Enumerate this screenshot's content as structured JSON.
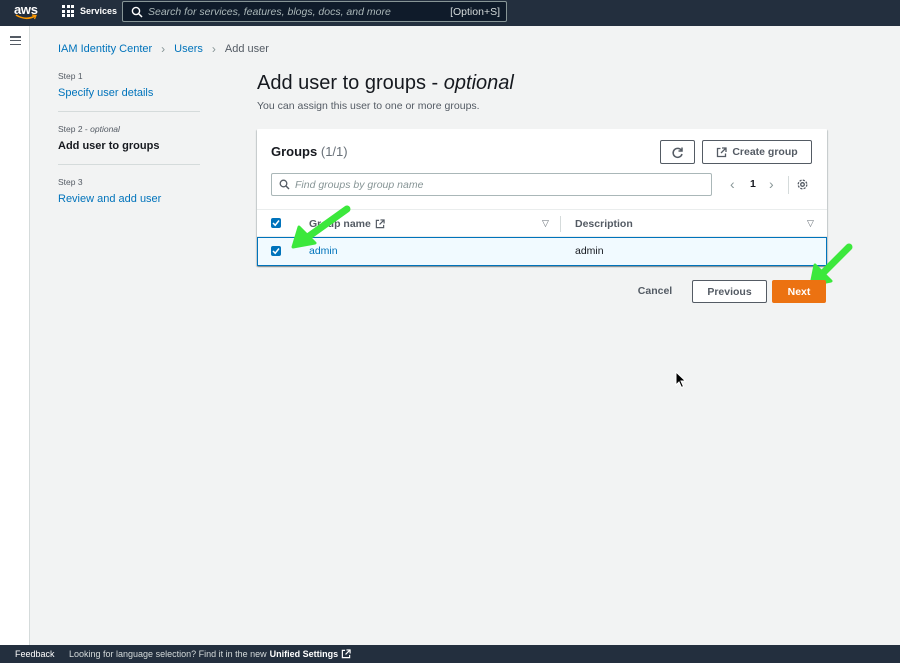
{
  "topnav": {
    "logo_text": "aws",
    "services_label": "Services",
    "search_placeholder": "Search for services, features, blogs, docs, and more",
    "search_shortcut": "[Option+S]"
  },
  "breadcrumb": [
    {
      "label": "IAM Identity Center"
    },
    {
      "label": "Users"
    },
    {
      "label": "Add user"
    }
  ],
  "steps": [
    {
      "num": "Step 1",
      "optional": "",
      "label": "Specify user details",
      "state": "link"
    },
    {
      "num": "Step 2 - ",
      "optional": "optional",
      "label": "Add user to groups",
      "state": "active"
    },
    {
      "num": "Step 3",
      "optional": "",
      "label": "Review and add user",
      "state": "link"
    }
  ],
  "page": {
    "heading_main": "Add user to groups - ",
    "heading_em": "optional",
    "description": "You can assign this user to one or more groups."
  },
  "groups_panel": {
    "title": "Groups",
    "count": "(1/1)",
    "create_label": "Create group",
    "filter_placeholder": "Find groups by group name",
    "current_page": "1",
    "columns": {
      "name": "Group name",
      "description": "Description"
    },
    "rows": [
      {
        "name": "admin",
        "description": "admin",
        "selected": true
      }
    ]
  },
  "actions": {
    "cancel": "Cancel",
    "previous": "Previous",
    "next": "Next"
  },
  "footer": {
    "feedback": "Feedback",
    "message": "Looking for language selection? Find it in the new",
    "link": "Unified Settings"
  },
  "colors": {
    "nav_bg": "#232f3e",
    "link": "#0073bb",
    "primary_button": "#ec7211",
    "annotation_arrow": "#3ce83c"
  }
}
